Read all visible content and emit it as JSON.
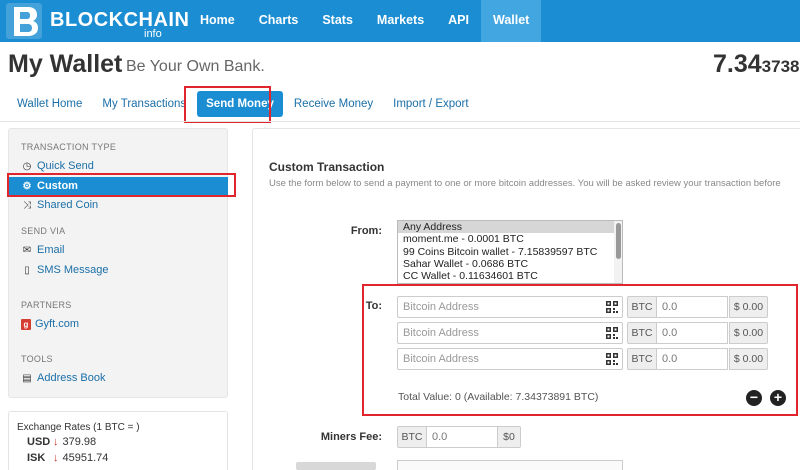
{
  "nav": {
    "logo_text": "BLOCKCHAIN",
    "logo_sub": "info",
    "items": [
      "Home",
      "Charts",
      "Stats",
      "Markets",
      "API",
      "Wallet"
    ],
    "active": "Wallet"
  },
  "header": {
    "title": "My Wallet",
    "subtitle": "Be Your Own Bank.",
    "balance_main": "7.34",
    "balance_small": "3738"
  },
  "tabs": [
    "Wallet Home",
    "My Transactions",
    "Send Money",
    "Receive Money",
    "Import / Export"
  ],
  "sidebar": {
    "transaction_type_head": "TRANSACTION TYPE",
    "quick_send": "Quick Send",
    "custom": "Custom",
    "shared_coin": "Shared Coin",
    "send_via_head": "SEND VIA",
    "email": "Email",
    "sms": "SMS Message",
    "partners_head": "PARTNERS",
    "gyft": "Gyft.com",
    "tools_head": "TOOLS",
    "address_book": "Address Book"
  },
  "exchange": {
    "title": "Exchange Rates (1 BTC = )",
    "rates": [
      {
        "code": "USD",
        "value": "379.98"
      },
      {
        "code": "ISK",
        "value": "45951.74"
      }
    ]
  },
  "form": {
    "title": "Custom Transaction",
    "description": "Use the form below to send a payment to one or more bitcoin addresses. You will be asked review your transaction before",
    "from_label": "From:",
    "from_options": [
      "Any Address",
      "moment.me - 0.0001 BTC",
      "99 Coins Bitcoin wallet - 7.15839597 BTC",
      "Sahar Wallet - 0.0686 BTC",
      "CC Wallet - 0.11634601 BTC"
    ],
    "to_label": "To:",
    "address_placeholder": "Bitcoin Address",
    "btc_label": "BTC",
    "amount_value": "0.0",
    "fiat_value": "$ 0.00",
    "total_text": "Total Value: 0 (Available: 7.34373891 BTC)",
    "remove_icon": "−",
    "add_icon": "+",
    "fee_label": "Miners Fee:",
    "fee_btc": "BTC",
    "fee_value": "0.0",
    "fee_fiat": "$0"
  }
}
